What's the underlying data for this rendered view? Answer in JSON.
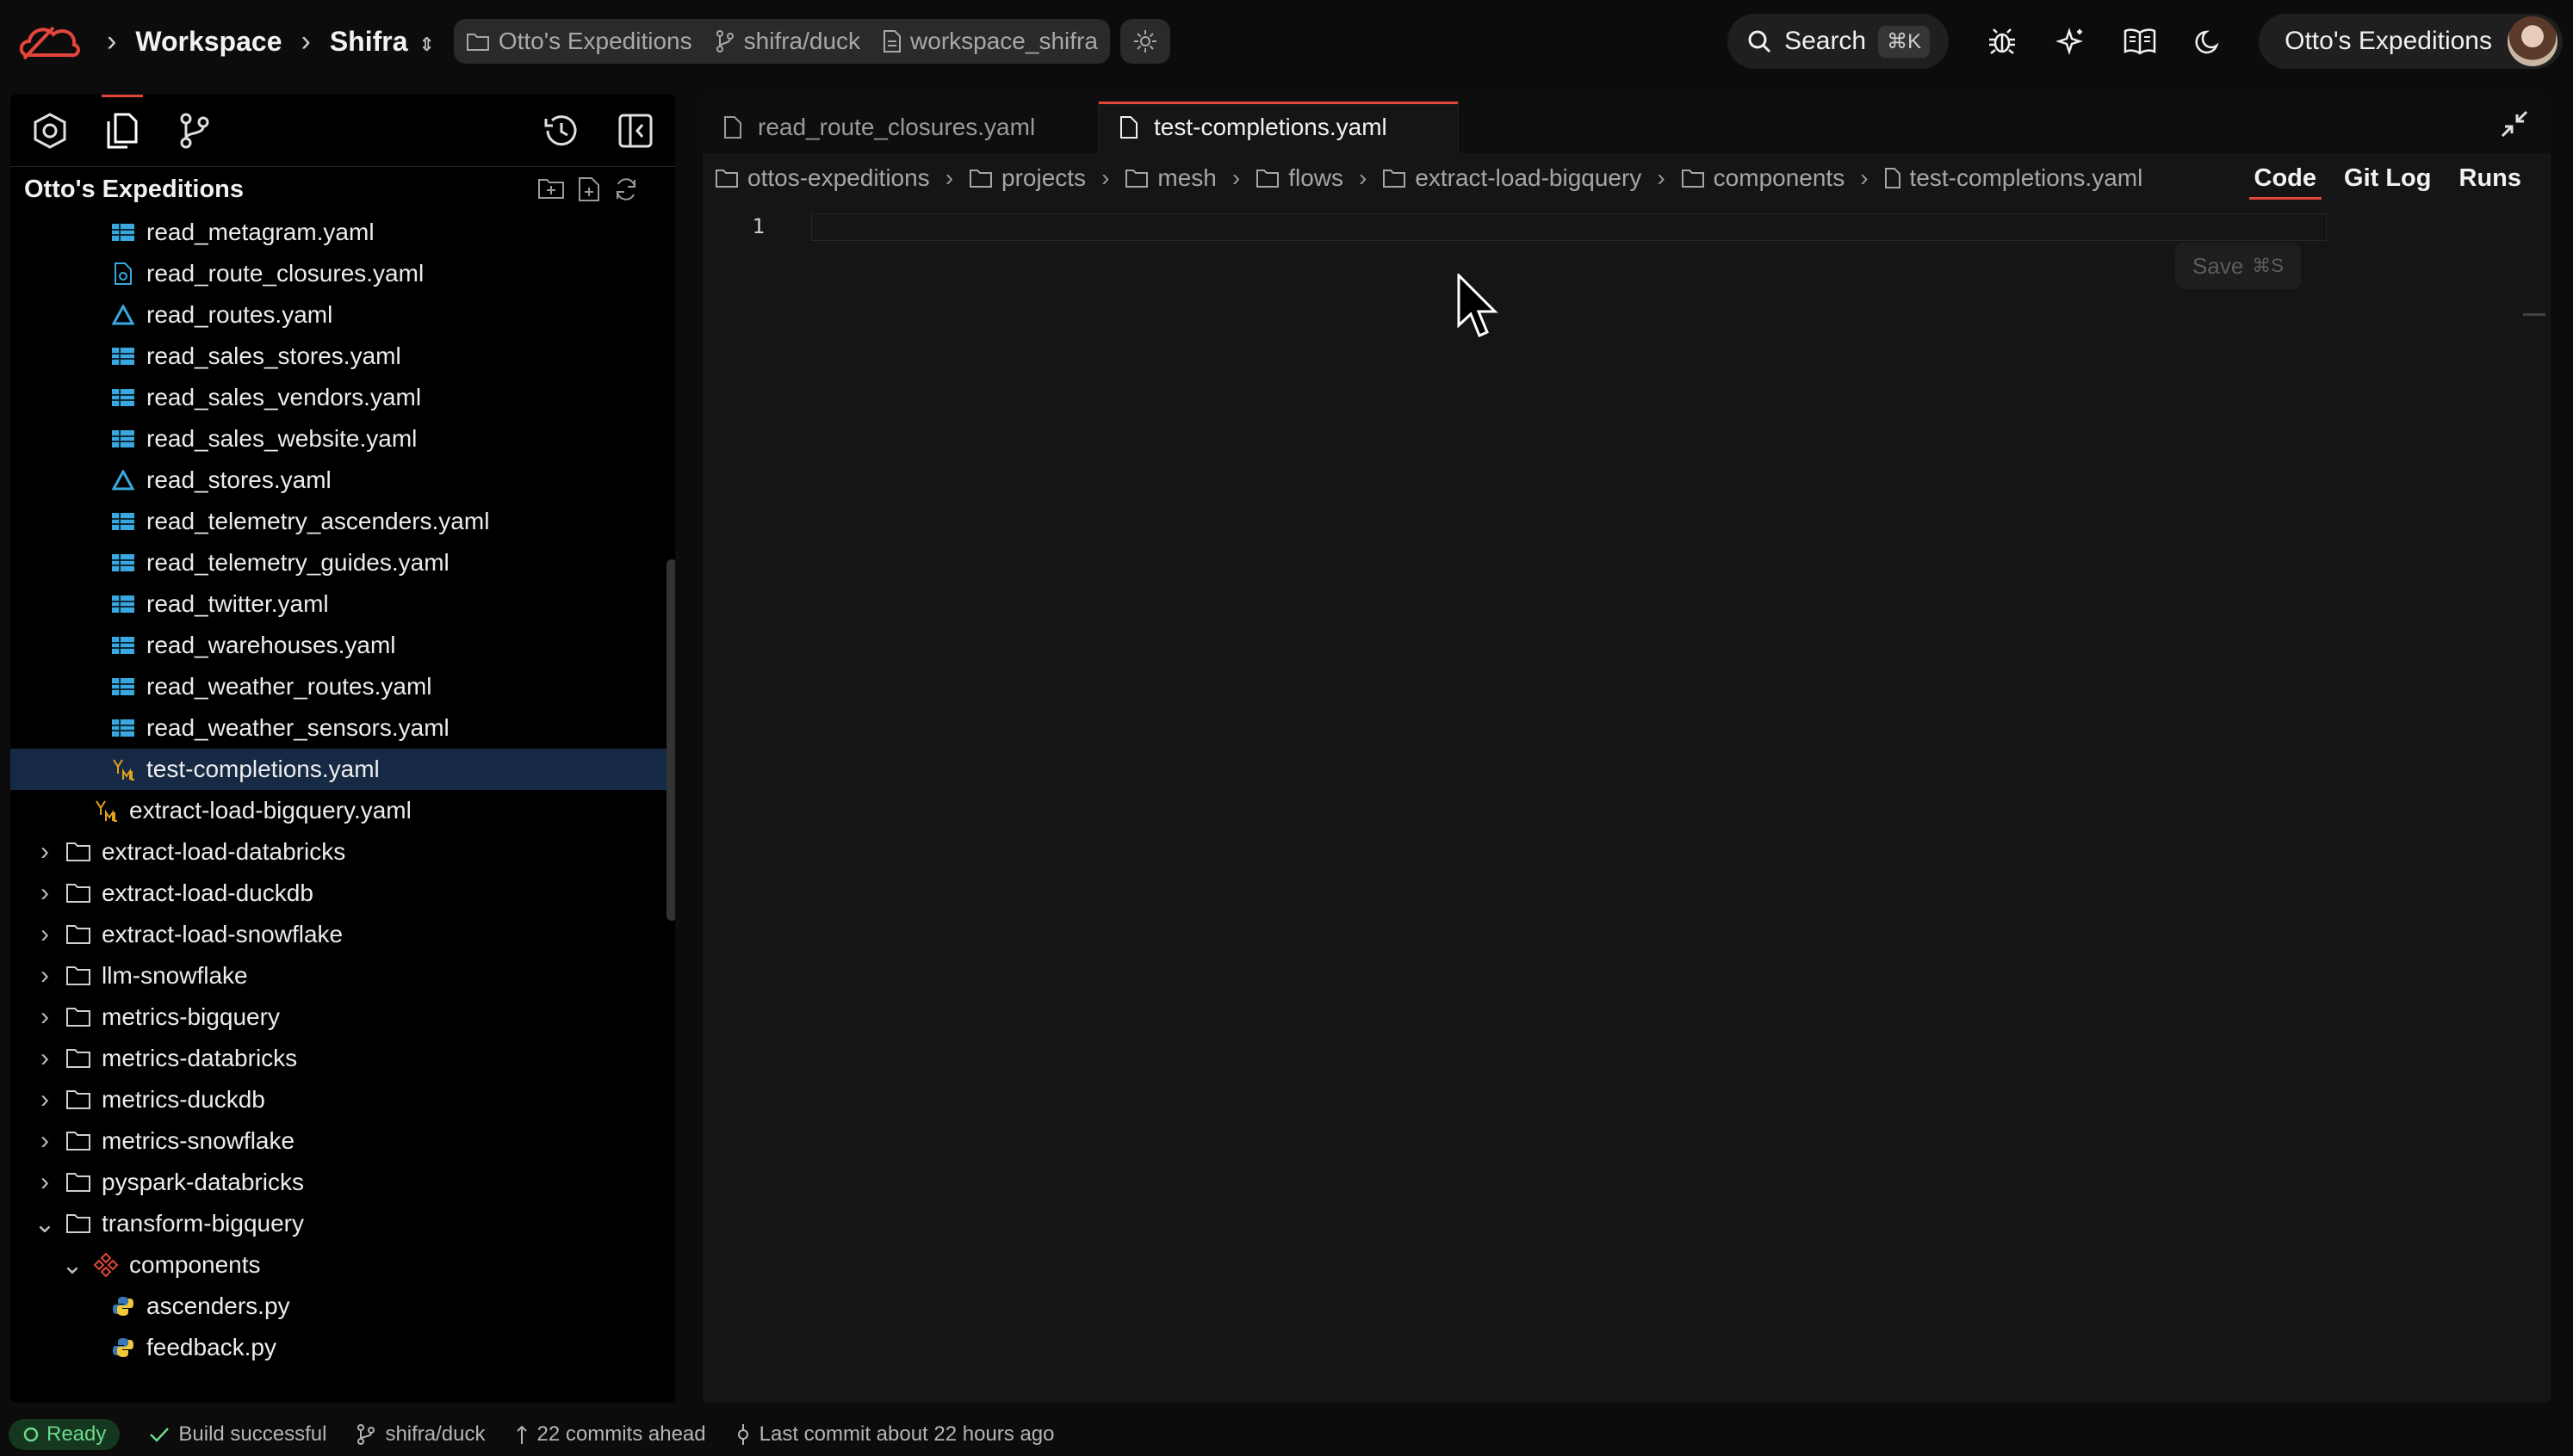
{
  "topbar": {
    "workspace_label": "Workspace",
    "user_project": "Shifra",
    "context": {
      "org": "Otto's Expeditions",
      "branch": "shifra/duck",
      "workspace": "workspace_shifra"
    },
    "search_label": "Search",
    "search_shortcut": "⌘K",
    "org_switcher": "Otto's Expeditions"
  },
  "sidebar": {
    "title": "Otto's Expeditions",
    "items": [
      {
        "label": "read_metagram.yaml",
        "icon": "table-icon",
        "depth": 3
      },
      {
        "label": "read_route_closures.yaml",
        "icon": "code-file-icon",
        "depth": 3
      },
      {
        "label": "read_routes.yaml",
        "icon": "bigquery-icon",
        "depth": 3
      },
      {
        "label": "read_sales_stores.yaml",
        "icon": "table-icon",
        "depth": 3
      },
      {
        "label": "read_sales_vendors.yaml",
        "icon": "table-icon",
        "depth": 3
      },
      {
        "label": "read_sales_website.yaml",
        "icon": "table-icon",
        "depth": 3
      },
      {
        "label": "read_stores.yaml",
        "icon": "bigquery-icon",
        "depth": 3
      },
      {
        "label": "read_telemetry_ascenders.yaml",
        "icon": "table-icon",
        "depth": 3
      },
      {
        "label": "read_telemetry_guides.yaml",
        "icon": "table-icon",
        "depth": 3
      },
      {
        "label": "read_twitter.yaml",
        "icon": "table-icon",
        "depth": 3
      },
      {
        "label": "read_warehouses.yaml",
        "icon": "table-icon",
        "depth": 3
      },
      {
        "label": "read_weather_routes.yaml",
        "icon": "table-icon",
        "depth": 3
      },
      {
        "label": "read_weather_sensors.yaml",
        "icon": "table-icon",
        "depth": 3
      },
      {
        "label": "test-completions.yaml",
        "icon": "yaml-icon",
        "depth": 3,
        "selected": true
      },
      {
        "label": "extract-load-bigquery.yaml",
        "icon": "yaml-icon",
        "depth": 2
      },
      {
        "label": "extract-load-databricks",
        "icon": "folder-icon",
        "depth": 1,
        "caret": "right"
      },
      {
        "label": "extract-load-duckdb",
        "icon": "folder-icon",
        "depth": 1,
        "caret": "right"
      },
      {
        "label": "extract-load-snowflake",
        "icon": "folder-icon",
        "depth": 1,
        "caret": "right"
      },
      {
        "label": "llm-snowflake",
        "icon": "folder-icon",
        "depth": 1,
        "caret": "right"
      },
      {
        "label": "metrics-bigquery",
        "icon": "folder-icon",
        "depth": 1,
        "caret": "right"
      },
      {
        "label": "metrics-databricks",
        "icon": "folder-icon",
        "depth": 1,
        "caret": "right"
      },
      {
        "label": "metrics-duckdb",
        "icon": "folder-icon",
        "depth": 1,
        "caret": "right"
      },
      {
        "label": "metrics-snowflake",
        "icon": "folder-icon",
        "depth": 1,
        "caret": "right"
      },
      {
        "label": "pyspark-databricks",
        "icon": "folder-icon",
        "depth": 1,
        "caret": "right"
      },
      {
        "label": "transform-bigquery",
        "icon": "folder-icon",
        "depth": 1,
        "caret": "down"
      },
      {
        "label": "components",
        "icon": "components-icon",
        "depth": 2,
        "caret": "down"
      },
      {
        "label": "ascenders.py",
        "icon": "python-icon",
        "depth": 3
      },
      {
        "label": "feedback.py",
        "icon": "python-icon",
        "depth": 3
      }
    ]
  },
  "editor": {
    "tabs": [
      {
        "label": "read_route_closures.yaml",
        "active": false
      },
      {
        "label": "test-completions.yaml",
        "active": true
      }
    ],
    "breadcrumb": [
      "ottos-expeditions",
      "projects",
      "mesh",
      "flows",
      "extract-load-bigquery",
      "components",
      "test-completions.yaml"
    ],
    "view_tabs": [
      "Code",
      "Git Log",
      "Runs"
    ],
    "active_view": "Code",
    "line_number": "1",
    "save_label": "Save",
    "save_shortcut": "⌘S"
  },
  "status": {
    "ready": "Ready",
    "build": "Build successful",
    "branch": "shifra/duck",
    "commits": "22 commits ahead",
    "last_commit": "Last commit about 22 hours ago"
  },
  "colors": {
    "accent": "#e2453c",
    "selected_row": "#172a45",
    "ready_green": "#6bd98a",
    "table_icon": "#3aa8e0",
    "yaml_icon": "#e0a21b"
  }
}
